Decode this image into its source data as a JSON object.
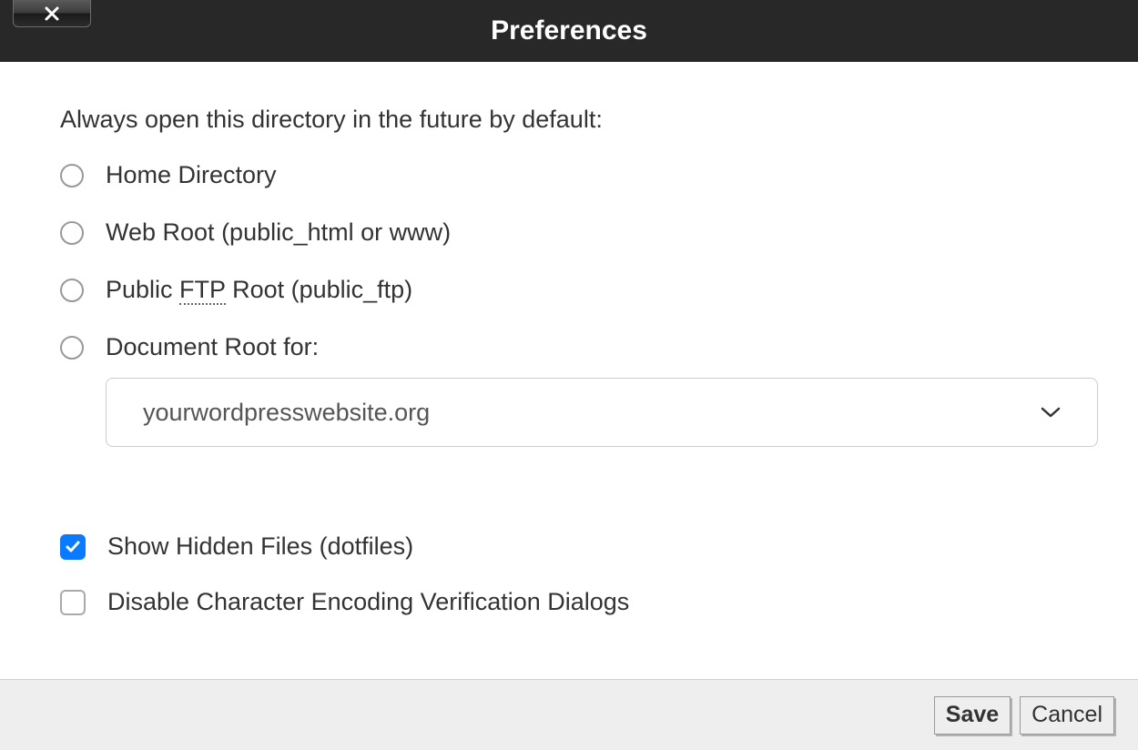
{
  "dialog": {
    "title": "Preferences"
  },
  "section": {
    "heading": "Always open this directory in the future by default:",
    "radios": [
      {
        "label": "Home Directory"
      },
      {
        "label_prefix": "Web Root (public_html or www)"
      },
      {
        "label_prefix": "Public ",
        "label_abbr": "FTP",
        "label_suffix": " Root (public_ftp)"
      },
      {
        "label": "Document Root for:"
      }
    ],
    "document_root_select": {
      "value": "yourwordpresswebsite.org"
    }
  },
  "checkboxes": {
    "show_hidden": {
      "label": "Show Hidden Files (dotfiles)",
      "checked": true
    },
    "disable_encoding": {
      "label": "Disable Character Encoding Verification Dialogs",
      "checked": false
    }
  },
  "buttons": {
    "save": "Save",
    "cancel": "Cancel"
  }
}
